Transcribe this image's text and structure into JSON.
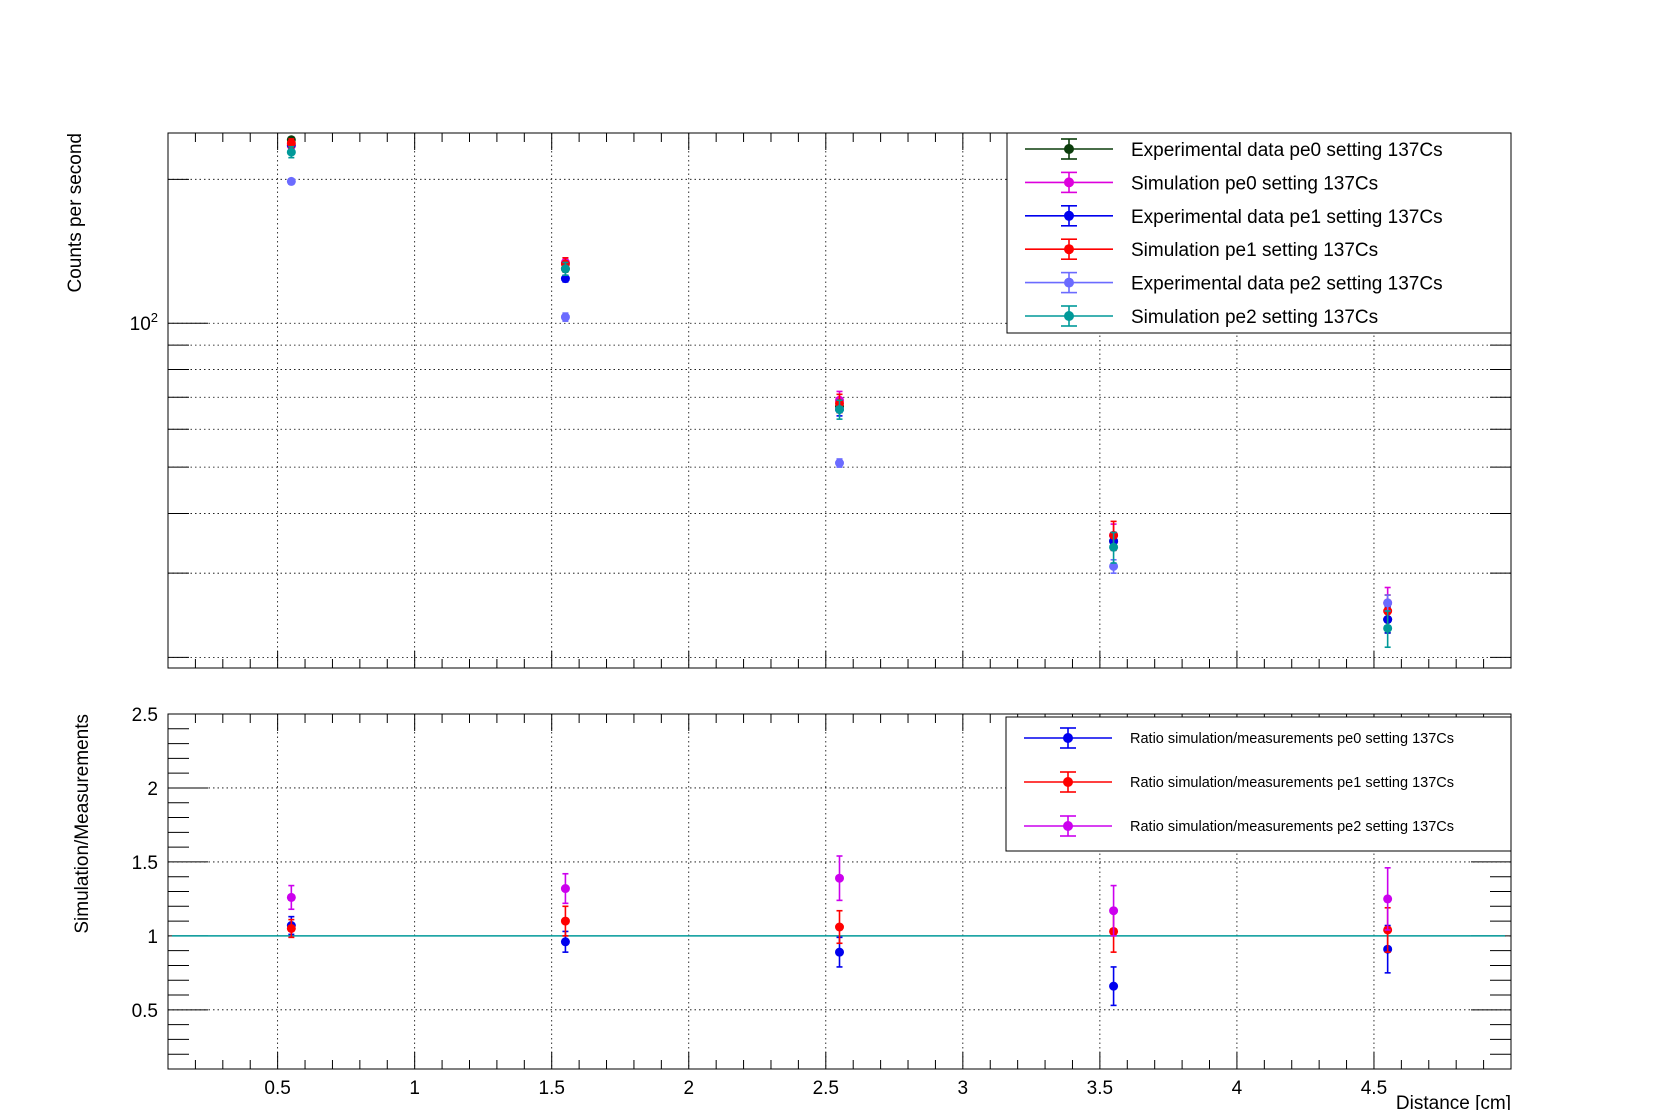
{
  "chart_data": [
    {
      "type": "scatter",
      "panel": "top",
      "title": "",
      "xlabel": "",
      "ylabel": "Counts per second",
      "yscale": "log",
      "xlim": [
        0.1,
        5.0
      ],
      "ylim": [
        19,
        250
      ],
      "grid": true,
      "legend_position": "top-right",
      "ytick_labels": [
        {
          "value": 100,
          "base": "10",
          "exp": "2"
        }
      ],
      "x": [
        0.55,
        1.55,
        2.55,
        3.55,
        4.55
      ],
      "series": [
        {
          "name": "Experimental data pe0 setting 137Cs",
          "color": "#0b3d0b",
          "values": [
            242,
            130,
            67,
            35,
            24
          ],
          "errors": [
            3,
            2,
            2,
            1.5,
            1.5
          ]
        },
        {
          "name": "Simulation pe0 setting 137Cs",
          "color": "#dd00dd",
          "values": [
            235,
            134,
            69,
            36,
            26
          ],
          "errors": [
            5,
            3,
            3,
            2,
            2
          ]
        },
        {
          "name": "Experimental data pe1 setting 137Cs",
          "color": "#0000ee",
          "values": [
            236,
            124,
            66,
            35,
            24
          ],
          "errors": [
            3,
            2,
            2,
            1.5,
            1.5
          ]
        },
        {
          "name": "Simulation pe1 setting 137Cs",
          "color": "#ff0000",
          "values": [
            238,
            133,
            68,
            36,
            25
          ],
          "errors": [
            5,
            4,
            3,
            2.5,
            2
          ]
        },
        {
          "name": "Experimental data pe2 setting 137Cs",
          "color": "#6b6bff",
          "values": [
            198,
            103,
            51,
            31,
            26
          ],
          "errors": [
            2,
            2,
            1,
            1,
            1
          ]
        },
        {
          "name": "Simulation pe2 setting 137Cs",
          "color": "#009999",
          "values": [
            228,
            130,
            66,
            34,
            23
          ],
          "errors": [
            6,
            4,
            3,
            2.5,
            2
          ]
        }
      ]
    },
    {
      "type": "scatter",
      "panel": "bottom",
      "title": "",
      "xlabel": "Distance [cm]",
      "ylabel": "Simulation/Measurements",
      "xlim": [
        0.1,
        5.0
      ],
      "ylim": [
        0.1,
        2.5
      ],
      "grid": true,
      "legend_position": "top-right",
      "xticks": [
        0.5,
        1,
        1.5,
        2,
        2.5,
        3,
        3.5,
        4,
        4.5
      ],
      "xtick_labels": [
        "0.5",
        "1",
        "1.5",
        "2",
        "2.5",
        "3",
        "3.5",
        "4",
        "4.5"
      ],
      "yticks": [
        0.5,
        1,
        1.5,
        2,
        2.5
      ],
      "ytick_labels": [
        "0.5",
        "1",
        "1.5",
        "2",
        "2.5"
      ],
      "reference_line": {
        "y": 1,
        "color": "#009999"
      },
      "x": [
        0.55,
        1.55,
        2.55,
        3.55,
        4.55
      ],
      "series": [
        {
          "name": "Ratio simulation/measurements pe0 setting 137Cs",
          "color": "#0000ee",
          "values": [
            1.07,
            0.96,
            0.89,
            0.66,
            0.91
          ],
          "errors": [
            0.06,
            0.07,
            0.1,
            0.13,
            0.16
          ]
        },
        {
          "name": "Ratio simulation/measurements pe1 setting 137Cs",
          "color": "#ff0000",
          "values": [
            1.05,
            1.1,
            1.06,
            1.03,
            1.04
          ],
          "errors": [
            0.06,
            0.1,
            0.11,
            0.14,
            0.15
          ]
        },
        {
          "name": "Ratio simulation/measurements pe2 setting 137Cs",
          "color": "#cc00ee",
          "values": [
            1.26,
            1.32,
            1.39,
            1.17,
            1.25
          ],
          "errors": [
            0.08,
            0.1,
            0.15,
            0.17,
            0.21
          ]
        }
      ]
    }
  ]
}
